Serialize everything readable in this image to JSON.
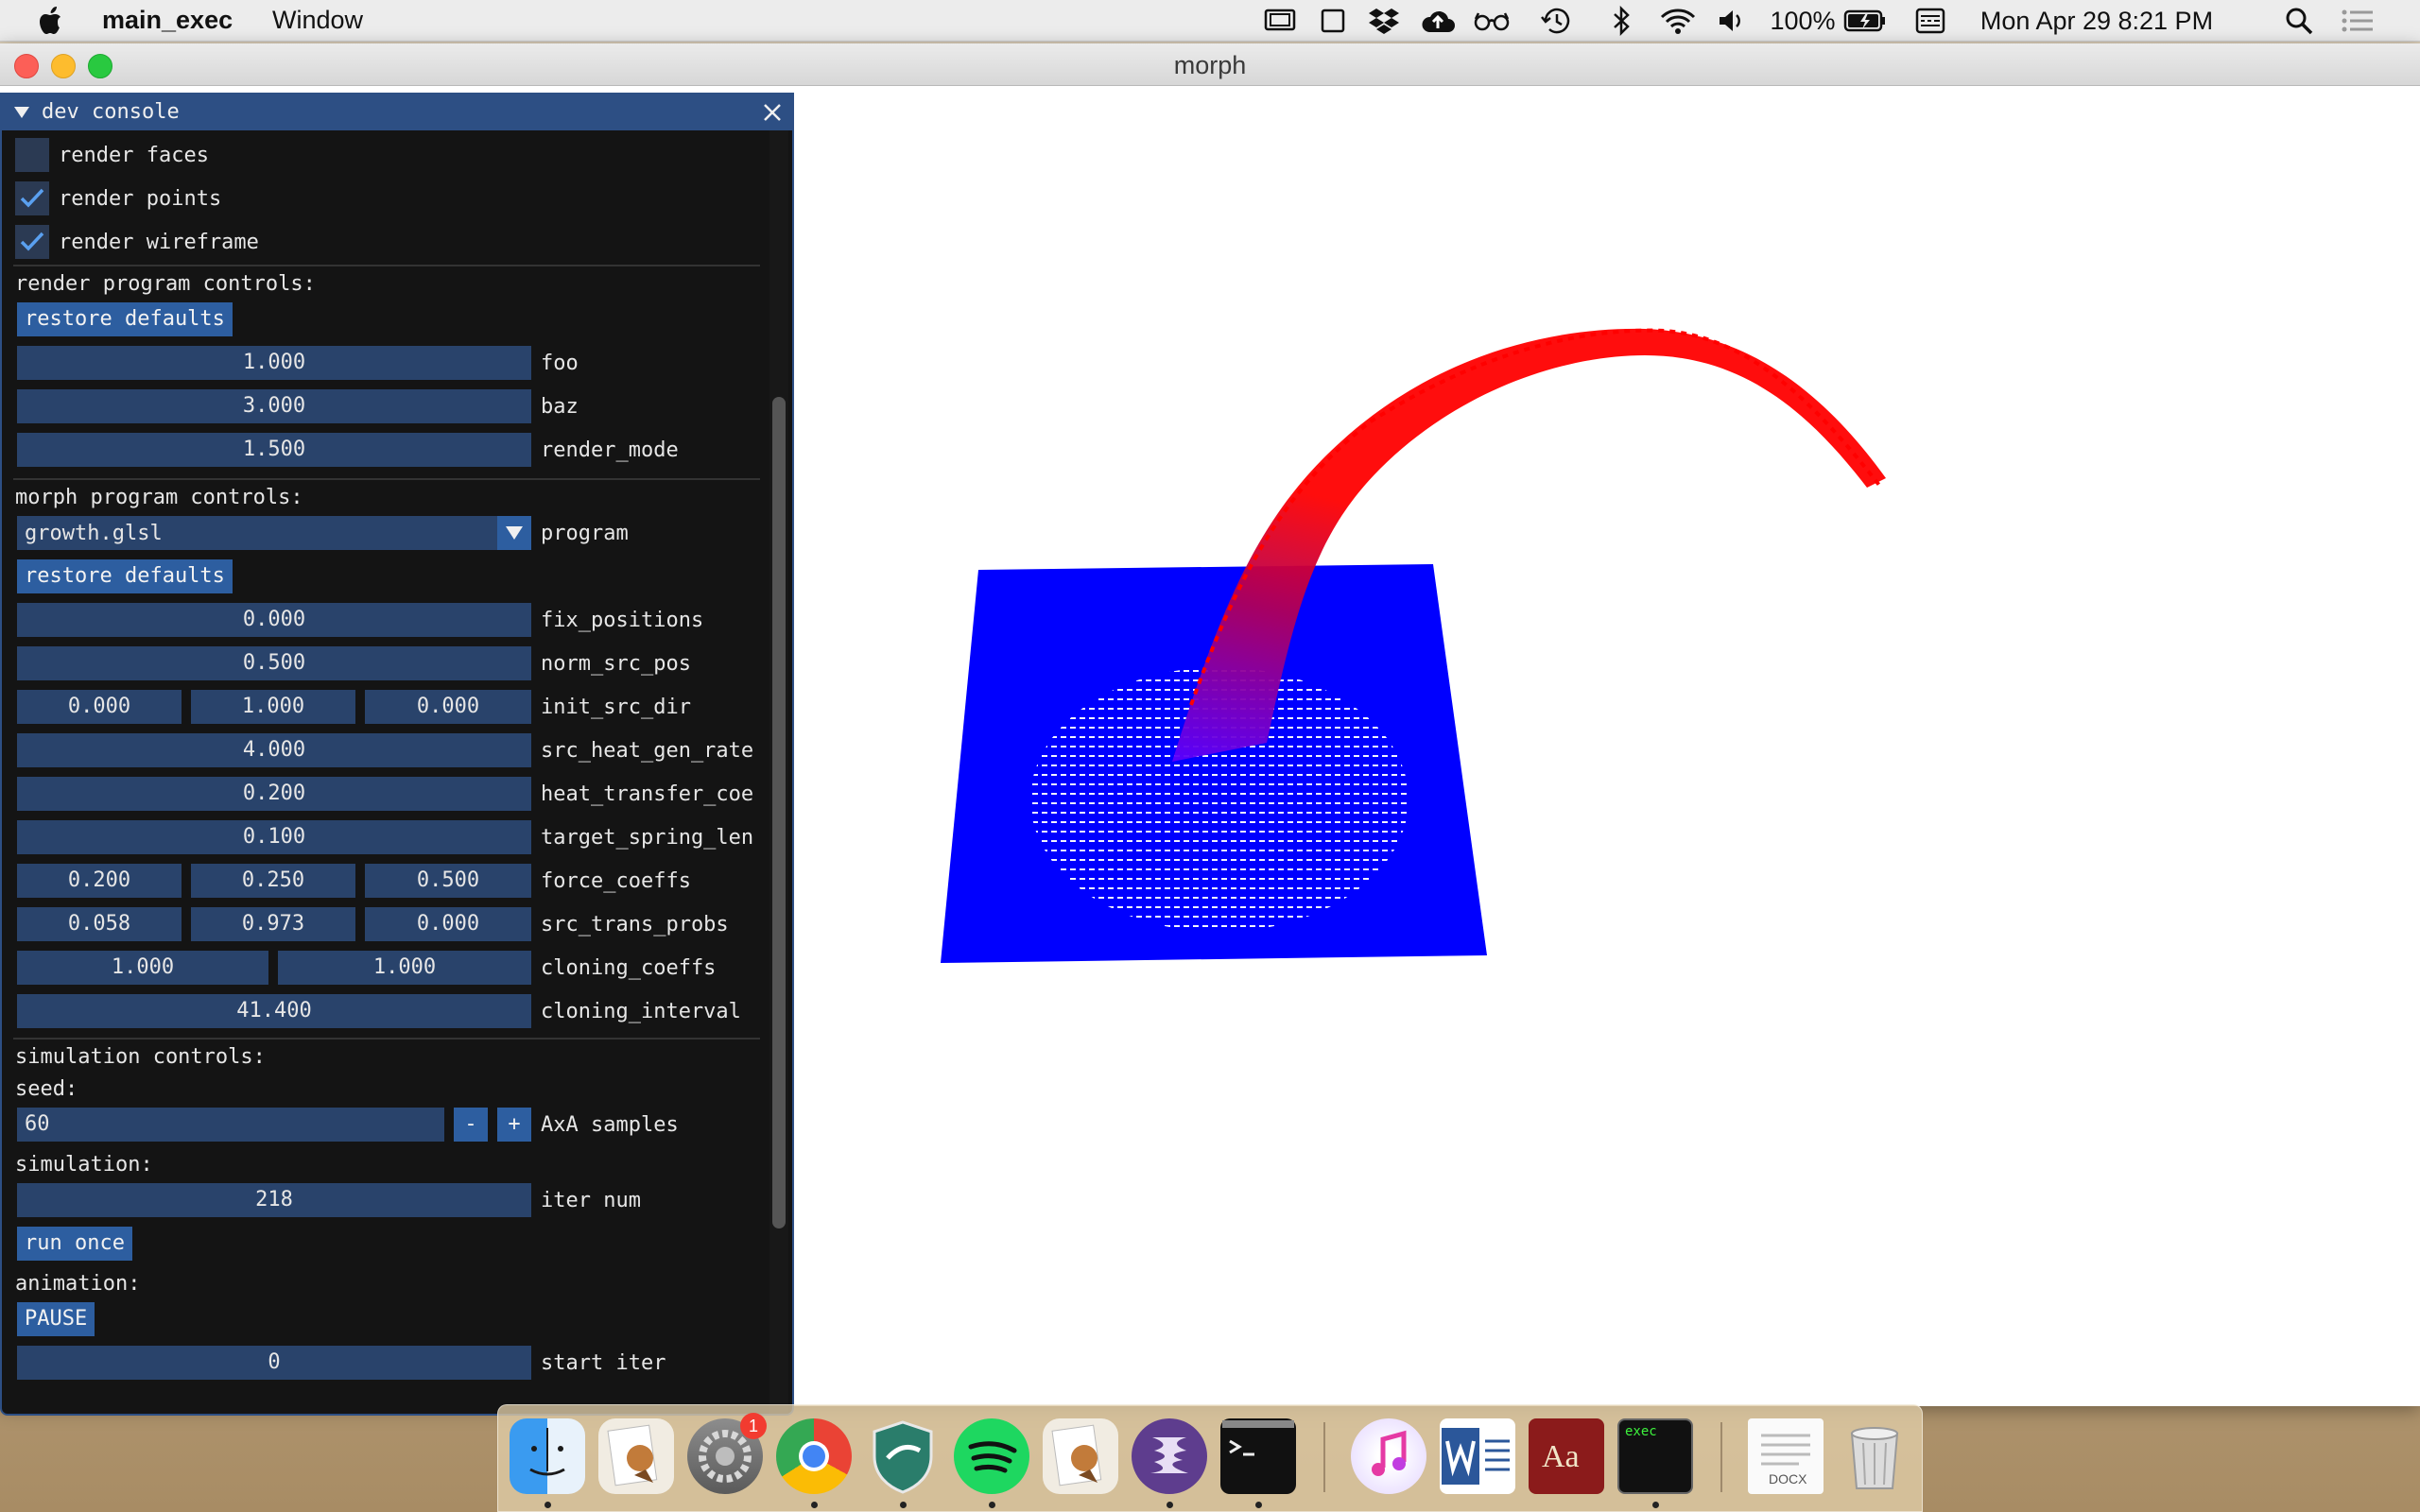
{
  "menubar": {
    "app_name": "main_exec",
    "menu_window": "Window",
    "battery": "100%",
    "datetime": "Mon Apr 29  8:21 PM",
    "status_icons": [
      "screen-mirror-icon",
      "display-icon",
      "dropbox-icon",
      "cloud-upload-icon",
      "glasses-icon",
      "time-machine-icon",
      "bluetooth-icon",
      "wifi-icon",
      "volume-icon",
      "battery-icon",
      "input-source-icon",
      "search-icon",
      "notification-center-icon"
    ]
  },
  "window": {
    "title": "morph"
  },
  "console": {
    "title": "dev console",
    "checkboxes": [
      {
        "label": "render faces",
        "checked": false
      },
      {
        "label": "render points",
        "checked": true
      },
      {
        "label": "render wireframe",
        "checked": true
      }
    ],
    "render_program": {
      "header": "render program controls:",
      "restore": "restore defaults",
      "params": [
        {
          "value": "1.000",
          "name": "foo"
        },
        {
          "value": "3.000",
          "name": "baz"
        },
        {
          "value": "1.500",
          "name": "render_mode"
        }
      ]
    },
    "morph_program": {
      "header": "morph program controls:",
      "program_value": "growth.glsl",
      "program_label": "program",
      "restore": "restore defaults",
      "params": [
        {
          "values": [
            "0.000"
          ],
          "name": "fix_positions"
        },
        {
          "values": [
            "0.500"
          ],
          "name": "norm_src_pos"
        },
        {
          "values": [
            "0.000",
            "1.000",
            "0.000"
          ],
          "name": "init_src_dir"
        },
        {
          "values": [
            "4.000"
          ],
          "name": "src_heat_gen_rate"
        },
        {
          "values": [
            "0.200"
          ],
          "name": "heat_transfer_coe"
        },
        {
          "values": [
            "0.100"
          ],
          "name": "target_spring_len"
        },
        {
          "values": [
            "0.200",
            "0.250",
            "0.500"
          ],
          "name": "force_coeffs"
        },
        {
          "values": [
            "0.058",
            "0.973",
            "0.000"
          ],
          "name": "src_trans_probs"
        },
        {
          "values": [
            "1.000",
            "1.000"
          ],
          "name": "cloning_coeffs"
        },
        {
          "values": [
            "41.400"
          ],
          "name": "cloning_interval"
        }
      ]
    },
    "simulation": {
      "header": "simulation controls:",
      "seed_label": "seed:",
      "seed_value": "60",
      "minus": "-",
      "plus": "+",
      "samples_label": "AxA samples",
      "simulation_label": "simulation:",
      "iter_value": "218",
      "iter_label": "iter num",
      "run_once": "run once",
      "animation_label": "animation:",
      "pause": "PAUSE",
      "start_iter_value": "0",
      "start_iter_label": "start iter"
    }
  },
  "colors": {
    "console_accent": "#2d4f84",
    "plane": "#0000ff",
    "tendril": "#ff0000"
  },
  "dock": {
    "apps": [
      "finder-icon",
      "preview-icon",
      "system-preferences-icon",
      "chrome-icon",
      "vpn-icon",
      "spotify-icon",
      "preview-icon",
      "emacs-icon",
      "terminal-icon",
      "itunes-icon",
      "word-icon",
      "dictionary-icon",
      "exec-icon",
      "docx-file-icon",
      "trash-icon"
    ],
    "badge": "1",
    "dictionary_text": "Aa",
    "exec_text": "exec",
    "docx_text": "DOCX"
  }
}
